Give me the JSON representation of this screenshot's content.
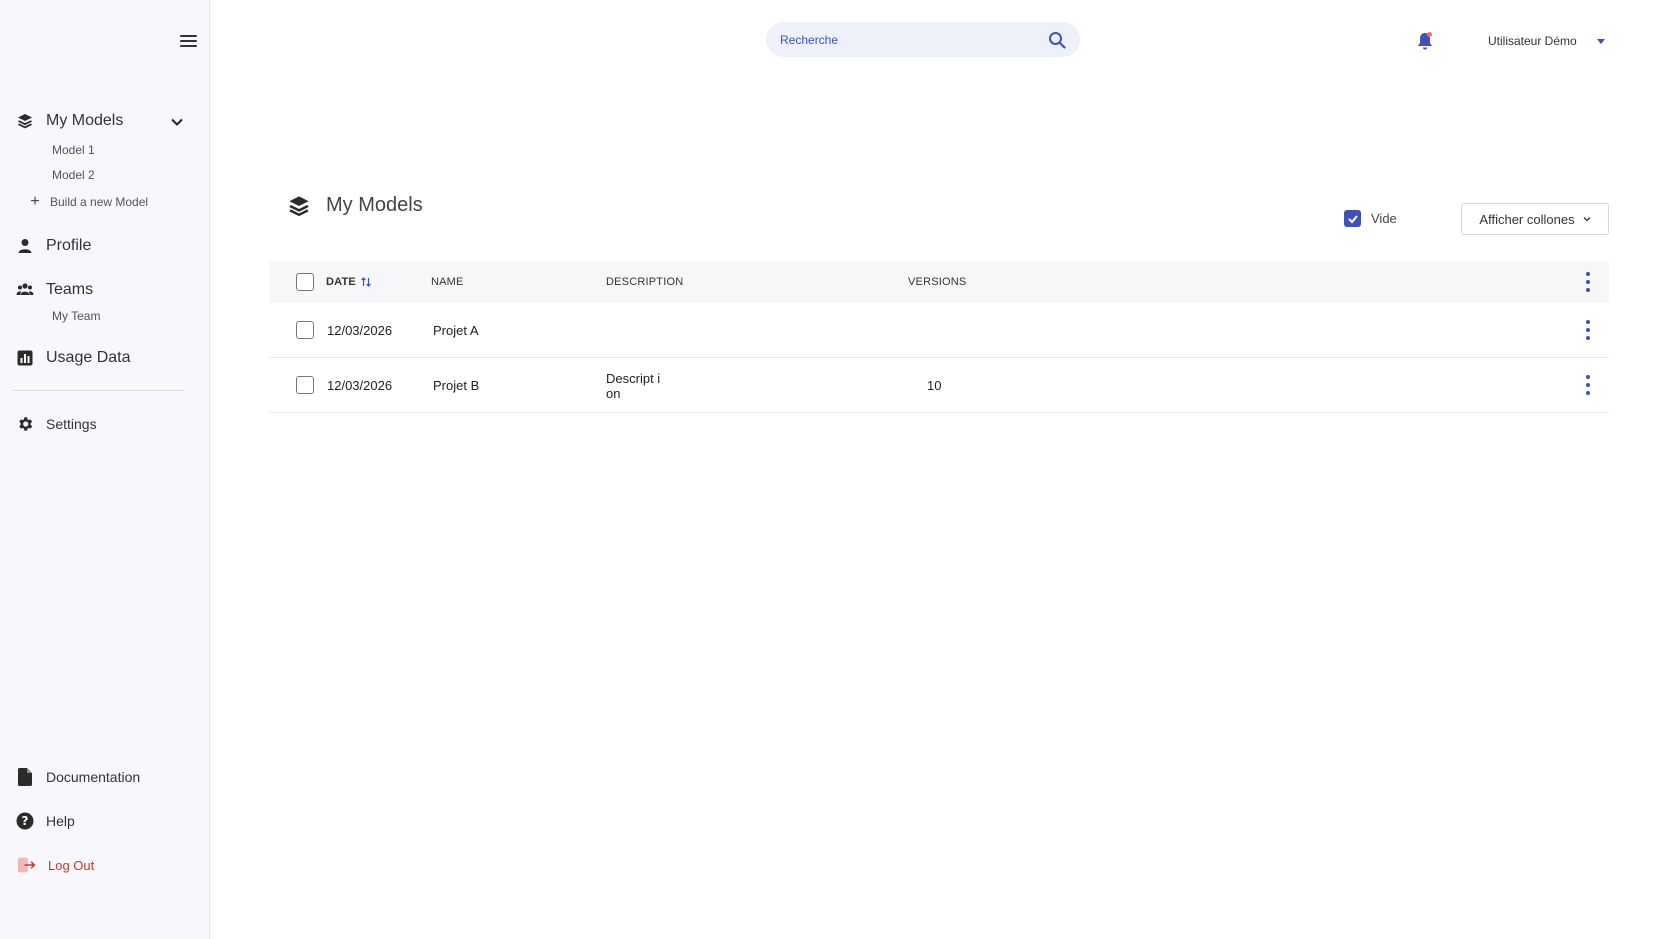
{
  "sidebar": {
    "my_models": "My Models",
    "models": [
      "Model 1",
      "Model 2"
    ],
    "build_new": "Build a new Model",
    "profile": "Profile",
    "teams": "Teams",
    "my_team": "My Team",
    "usage_data": "Usage Data",
    "settings": "Settings",
    "documentation": "Documentation",
    "help": "Help",
    "logout": "Log Out"
  },
  "topbar": {
    "search_placeholder": "Recherche",
    "user_name": "Utilisateur Démo"
  },
  "page": {
    "title": "My Models",
    "vide_label": "Vide",
    "vide_checked": true,
    "columns_button": "Afficher collones"
  },
  "table": {
    "headers": {
      "date": "DATE",
      "name": "NAME",
      "description": "DESCRIPTION",
      "versions": "VERSIONS"
    },
    "rows": [
      {
        "date": "12/03/2026",
        "name": "Projet A",
        "description": "",
        "versions": ""
      },
      {
        "date": "12/03/2026",
        "name": "Projet B",
        "description": "Descript ion",
        "versions": "10"
      }
    ]
  },
  "colors": {
    "accent": "#3f51b5",
    "logout": "#c0392b",
    "sidebar_bg": "#f8f8fc"
  },
  "icons": [
    "hamburger-icon",
    "layers-icon",
    "chevron-down-icon",
    "plus-icon",
    "person-icon",
    "teams-icon",
    "chart-icon",
    "gear-icon",
    "document-icon",
    "help-icon",
    "logout-icon",
    "search-icon",
    "bell-icon",
    "sort-icon",
    "kebab-icon",
    "check-icon"
  ]
}
